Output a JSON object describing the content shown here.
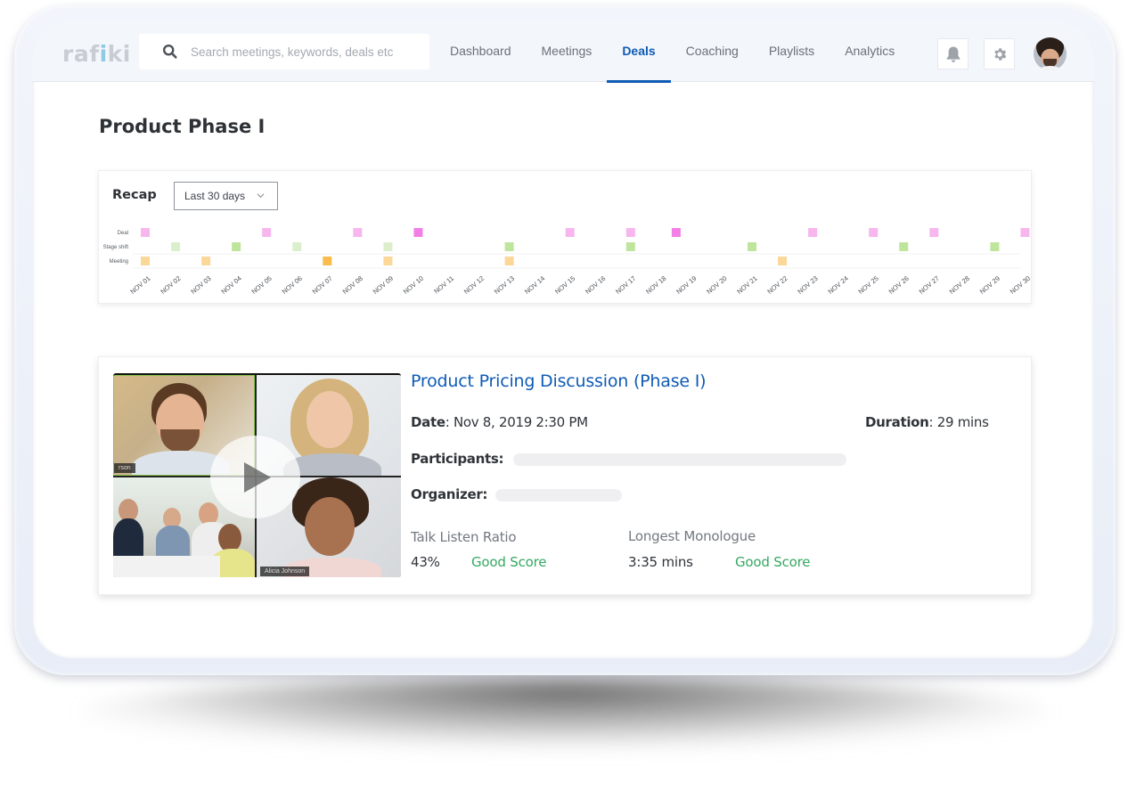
{
  "app": {
    "logo_text_1": "raf",
    "logo_text_accent": "i",
    "logo_text_2": "ki",
    "brand_color": "#0f5bb5"
  },
  "search": {
    "placeholder": "Search meetings, keywords, deals etc",
    "value": ""
  },
  "nav": {
    "tabs": [
      {
        "label": "Dashboard",
        "active": false
      },
      {
        "label": "Meetings",
        "active": false
      },
      {
        "label": "Deals",
        "active": true
      },
      {
        "label": "Coaching",
        "active": false
      },
      {
        "label": "Playlists",
        "active": false
      },
      {
        "label": "Analytics",
        "active": false
      }
    ],
    "icons": [
      "bell-icon",
      "gear-icon",
      "avatar"
    ]
  },
  "page": {
    "title": "Product Phase I"
  },
  "recap": {
    "title": "Recap",
    "range_selected": "Last 30 days"
  },
  "chart_data": {
    "type": "scatter",
    "title": "Recap",
    "rows": [
      "Deal",
      "Stage shift",
      "Meeting"
    ],
    "x_ticks": [
      "NOV 01",
      "NOV 02",
      "NOV 03",
      "NOV 04",
      "NOV 05",
      "NOV 06",
      "NOV 07",
      "NOV 08",
      "NOV 09",
      "NOV 10",
      "NOV 11",
      "NOV 12",
      "NOV 13",
      "NOV 14",
      "NOV 15",
      "NOV 16",
      "NOV 17",
      "NOV 18",
      "NOV 19",
      "NOV 20",
      "NOV 21",
      "NOV 22",
      "NOV 23",
      "NOV 24",
      "NOV 25",
      "NOV 26",
      "NOV 27",
      "NOV 28",
      "NOV 29",
      "NOV 30"
    ],
    "series": [
      {
        "name": "Deal",
        "color": "#f7b6ee",
        "highlight_color": "#f27fe6",
        "points": [
          {
            "day": 1,
            "highlight": false
          },
          {
            "day": 5,
            "highlight": false
          },
          {
            "day": 8,
            "highlight": false
          },
          {
            "day": 10,
            "highlight": true
          },
          {
            "day": 15,
            "highlight": false
          },
          {
            "day": 17,
            "highlight": false
          },
          {
            "day": 18.5,
            "highlight": true
          },
          {
            "day": 23,
            "highlight": false
          },
          {
            "day": 25,
            "highlight": false
          },
          {
            "day": 27,
            "highlight": false
          },
          {
            "day": 30,
            "highlight": false
          }
        ]
      },
      {
        "name": "Stage shift",
        "color": "#bfe59c",
        "light_color": "#dcefcd",
        "points": [
          {
            "day": 2,
            "light": true
          },
          {
            "day": 4,
            "light": false
          },
          {
            "day": 6,
            "light": true
          },
          {
            "day": 9,
            "light": true
          },
          {
            "day": 13,
            "light": false
          },
          {
            "day": 17,
            "light": false
          },
          {
            "day": 21,
            "light": false
          },
          {
            "day": 26,
            "light": false
          },
          {
            "day": 29,
            "light": false
          }
        ]
      },
      {
        "name": "Meeting",
        "color": "#fbd798",
        "highlight_color": "#fbbc4d",
        "points": [
          {
            "day": 1,
            "highlight": false
          },
          {
            "day": 3,
            "highlight": false
          },
          {
            "day": 7,
            "highlight": true
          },
          {
            "day": 9,
            "highlight": false
          },
          {
            "day": 13,
            "highlight": false
          },
          {
            "day": 22,
            "highlight": false
          }
        ]
      }
    ],
    "xlabel": "",
    "ylabel": "",
    "grid": true
  },
  "meeting": {
    "title": "Product Pricing Discussion (Phase I)",
    "date_label": "Date",
    "date_value": ": Nov 8, 2019 2:30 PM",
    "duration_label": "Duration",
    "duration_value": ": 29 mins",
    "participants_label": "Participants:",
    "organizer_label": "Organizer:",
    "video_tag_1": "rson",
    "video_tag_2": "Alicia Johnson",
    "stats": {
      "talk_listen_label": "Talk Listen Ratio",
      "talk_listen_value": "43%",
      "talk_listen_score": "Good Score",
      "monologue_label": "Longest Monologue",
      "monologue_value": "3:35 mins",
      "monologue_score": "Good Score",
      "score_color": "#35a861"
    }
  }
}
